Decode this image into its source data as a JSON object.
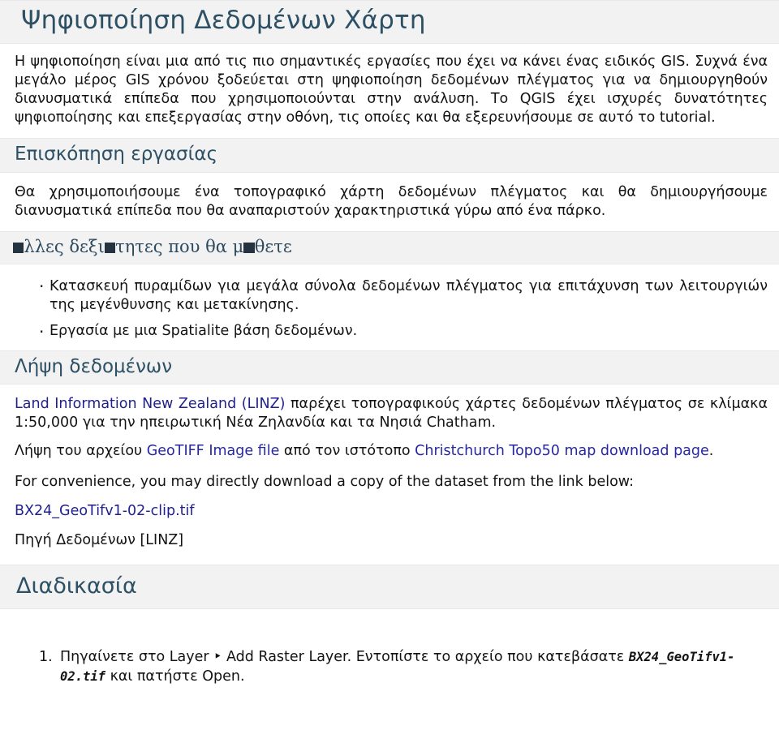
{
  "document": {
    "title": "Ψηφιοποίηση Δεδομένων Χάρτη"
  },
  "colors": {
    "heading": "#2d5065",
    "heading_serif": "#2c4a60",
    "band_background": "#f2f2f2",
    "link": "#1f1f8f",
    "link_bright": "#2727a6",
    "body_text": "#131313",
    "tofu_box": "#24333f"
  },
  "intro": {
    "paragraph": "Η ψηφιοποίηση είναι μια από τις πιο σημαντικές εργασίες που έχει να κάνει ένας ειδικός GIS. Συχνά ένα μεγάλο μέρος GIS χρόνου ξοδεύεται στη ψηφιοποίηση δεδομένων πλέγματος για να δημιουργηθούν διανυσματικά επίπεδα που χρησιμοποιούνται στην ανάλυση. Το QGIS έχει ισχυρές δυνατότητες ψηφιοποίησης και επεξεργασίας στην οθόνη, τις οποίες και θα εξερευνήσουμε σε αυτό το tutorial."
  },
  "overview": {
    "heading": "Επισκόπηση εργασίας",
    "paragraph": "Θα χρησιμοποιήσουμε ένα τοπογραφικό χάρτη δεδομένων πλέγματος και θα δημιουργήσουμε διανυσματικά επίπεδα που θα αναπαριστούν χαρακτηριστικά γύρω από ένα πάρκο."
  },
  "skills": {
    "heading_parts": {
      "before": "",
      "a": "λλες δεξι",
      "b": "τητες που θα μ",
      "c": "θετε"
    },
    "heading_plain": "Άλλες δεξιότητες που θα μάθετε",
    "items": [
      "Κατασκευή πυραμίδων για μεγάλα σύνολα δεδομένων πλέγματος για επιτάχυνση των λειτουργιών της μεγένθυνσης και μετακίνησης.",
      "Εργασία με μια Spatialite βάση δεδομένων."
    ]
  },
  "data_download": {
    "heading": "Λήψη δεδομένων",
    "paragraph1": {
      "link": "Land Information New Zealand (LINZ)",
      "rest": " παρέχει τοπογραφικούς χάρτες δεδομένων πλέγματος σε κλίμακα 1:50,000 για την ηπειρωτική Νέα Ζηλανδία και τα Νησιά Chatham."
    },
    "paragraph2": {
      "prefix": "Λήψη του αρχείου ",
      "link1": "GeoTIFF Image file",
      "middle": " από τον ιστότοπο ",
      "link2": "Christchurch Topo50 map download page",
      "suffix": "."
    },
    "convenience_note": "For convenience, you may directly download a copy of the dataset from the link below:",
    "dataset_link": "BX24_GeoTifv1-02-clip.tif",
    "source_note": "Πηγή Δεδομένων [LINZ]"
  },
  "procedure": {
    "heading": "Διαδικασία",
    "steps": [
      {
        "text_before": "Πηγαίνετε στο Layer ‣ Add Raster Layer. Εντοπίστε το αρχείο που κατεβάσατε ",
        "code": "BX24_GeoTifv1-02.tif",
        "text_after": " και πατήστε Open."
      }
    ]
  }
}
